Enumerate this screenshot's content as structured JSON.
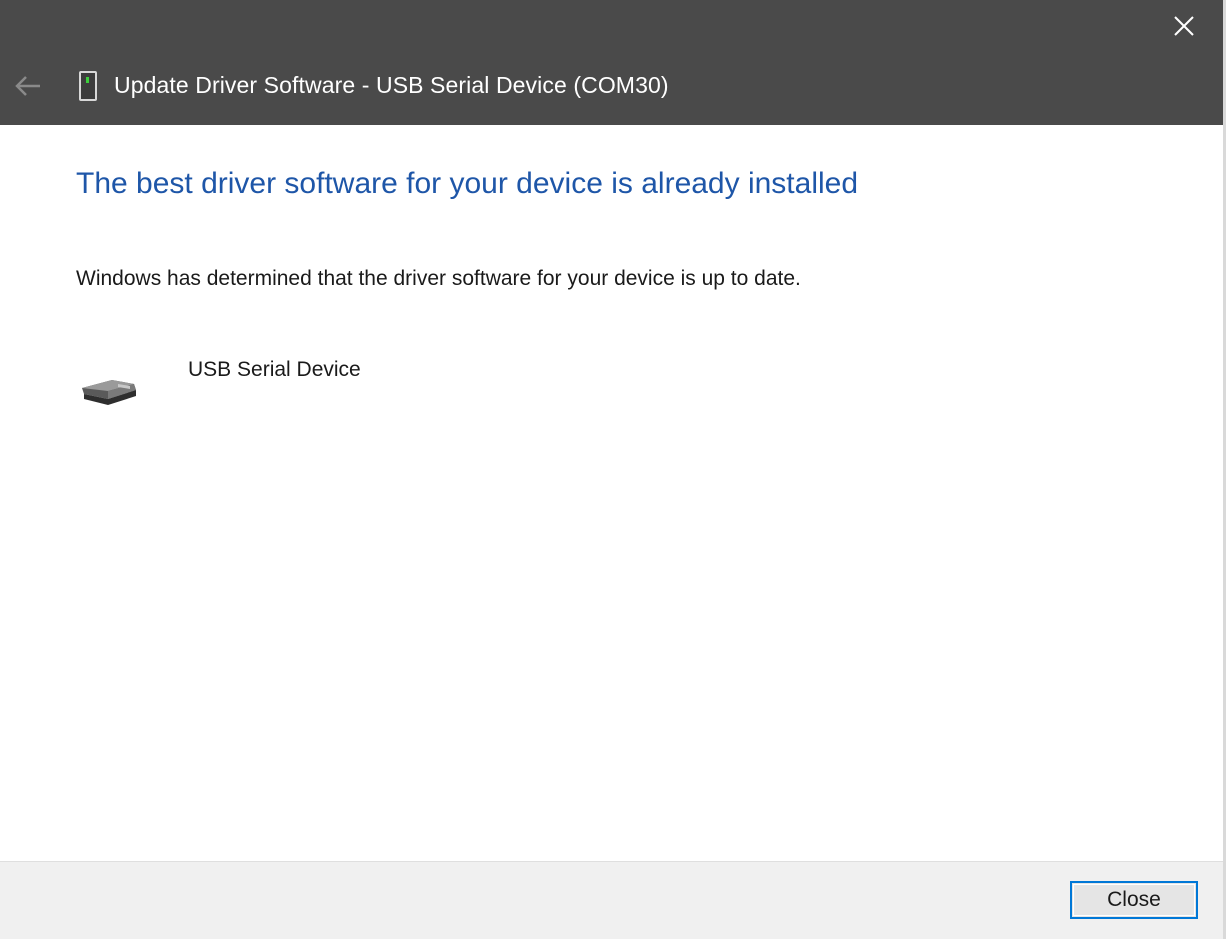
{
  "window": {
    "title": "Update Driver Software - USB Serial Device (COM30)"
  },
  "main": {
    "heading": "The best driver software for your device is already installed",
    "message": "Windows has determined that the driver software for your device is up to date.",
    "device": {
      "name": "USB Serial Device",
      "icon": "usb-device-icon"
    }
  },
  "footer": {
    "close_label": "Close"
  },
  "icons": {
    "back": "back-arrow-icon",
    "title": "device-manager-icon",
    "close": "close-icon"
  },
  "colors": {
    "titlebar": "#4a4a4a",
    "heading": "#1e56a8",
    "button_border": "#0078d7",
    "footer": "#f0f0f0"
  }
}
